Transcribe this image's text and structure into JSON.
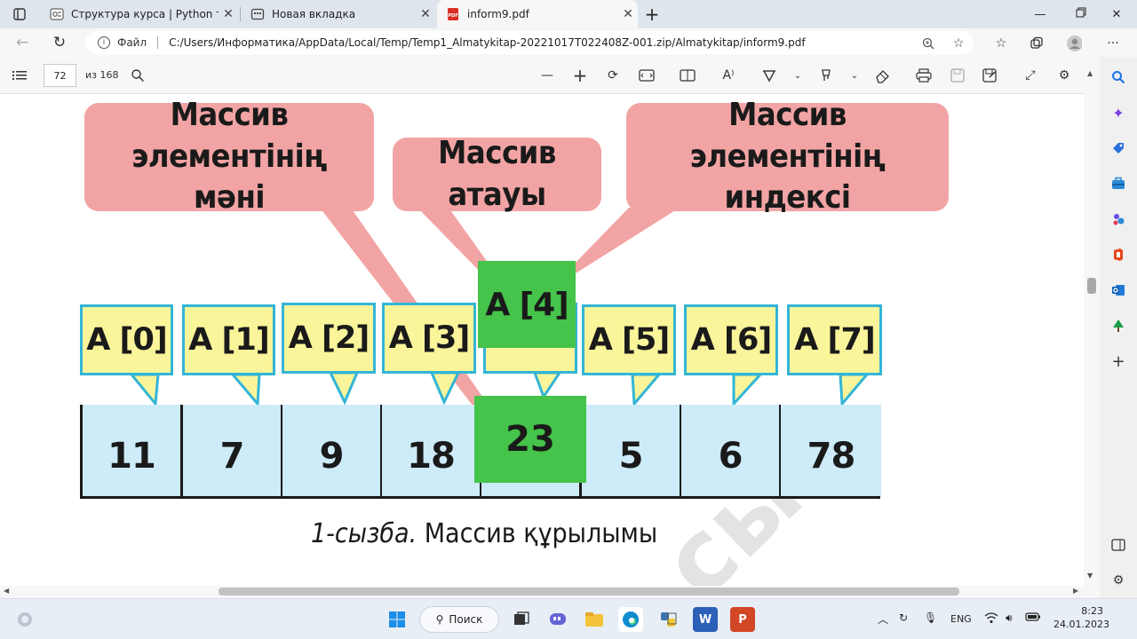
{
  "browser": {
    "tabs": [
      {
        "title": "Структура курса | Python тілінде",
        "icon": "course-icon"
      },
      {
        "title": "Новая вкладка",
        "icon": "new-tab-icon"
      },
      {
        "title": "inform9.pdf",
        "icon": "pdf-icon",
        "active": true
      }
    ],
    "new_tab": "+",
    "address": {
      "scheme_label": "Файл",
      "url": "C:/Users/Информатика/AppData/Local/Temp/Temp1_Almatykitap-20221017T022408Z-001.zip/Almatykitap/inform9.pdf"
    }
  },
  "pdf_toolbar": {
    "page": "72",
    "total": "из 168"
  },
  "diagram": {
    "callouts": {
      "value": "Массив элементінің мәні",
      "name": "Массив атауы",
      "index": "Массив элементінің индексі"
    },
    "labels": [
      "A [0]",
      "A [1]",
      "A [2]",
      "A [3]",
      "A [4]",
      "A [5]",
      "A [6]",
      "A [7]"
    ],
    "values": [
      "11",
      "7",
      "9",
      "18",
      "23",
      "5",
      "6",
      "78"
    ],
    "caption_italic": "1-сызба.",
    "caption_text": " Массив құрылымы",
    "watermark": "сы"
  },
  "taskbar": {
    "search": "Поиск",
    "lang": "ENG",
    "time": "8:23",
    "date": "24.01.2023"
  }
}
